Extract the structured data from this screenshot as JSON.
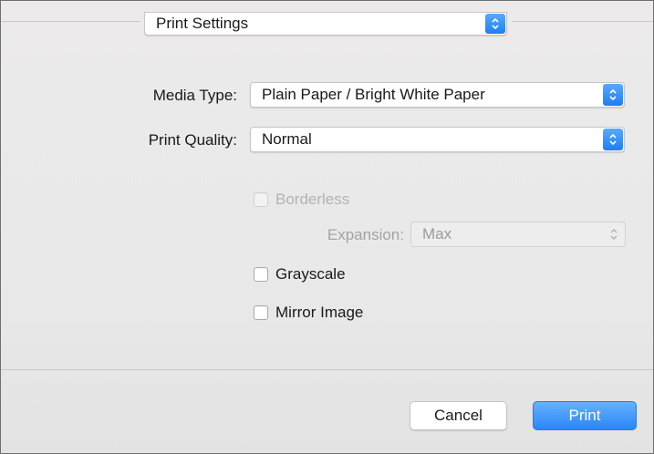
{
  "header": {
    "presets_popup": "Print Settings"
  },
  "media_type": {
    "label": "Media Type:",
    "value": "Plain Paper / Bright White Paper"
  },
  "print_quality": {
    "label": "Print Quality:",
    "value": "Normal"
  },
  "borderless": {
    "label": "Borderless",
    "checked": false,
    "enabled": false
  },
  "expansion": {
    "label": "Expansion:",
    "value": "Max",
    "enabled": false
  },
  "grayscale": {
    "label": "Grayscale",
    "checked": false
  },
  "mirror_image": {
    "label": "Mirror Image",
    "checked": false
  },
  "buttons": {
    "cancel": "Cancel",
    "print": "Print"
  },
  "colors": {
    "accent": "#2a85f7"
  }
}
